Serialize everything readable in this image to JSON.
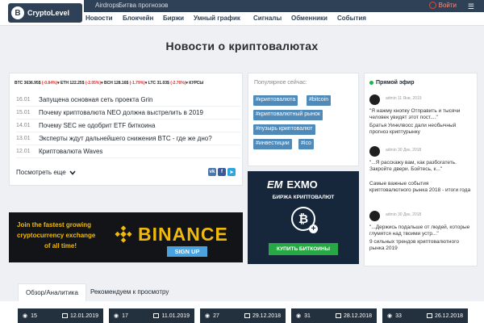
{
  "header": {
    "logo_text": "CryptoLevel",
    "logo_mark": "B",
    "subnav": [
      "Airdrops",
      "Битва прогнозов"
    ],
    "login_label": "Войти",
    "login_icon": "power-icon",
    "menu_icon": "hamburger-icon",
    "mainnav": [
      "Новости",
      "Блокчейн",
      "Биржи",
      "Умный график",
      "Сигналы",
      "Обменники",
      "События"
    ]
  },
  "page": {
    "title": "Новости о криптовалютах"
  },
  "ticker": [
    {
      "symbol": "BTC",
      "price": "3636.95$",
      "change": "(-0.84%)"
    },
    {
      "symbol": "ETH",
      "price": "122.25$",
      "change": "(-2.05%)"
    },
    {
      "symbol": "BCH",
      "price": "128.16$",
      "change": "(-1.79%)"
    },
    {
      "symbol": "LTC",
      "price": "31.03$",
      "change": "(-2.76%)"
    },
    {
      "label": "КУРСЫ"
    }
  ],
  "news": {
    "items": [
      {
        "date": "16.01",
        "title": "Запущена основная сеть проекта Grin"
      },
      {
        "date": "15.01",
        "title": "Почему криптовалюта NEO должна выстрелить в 2019"
      },
      {
        "date": "14.01",
        "title": "Почему SEC не одобрит ETF биткоина"
      },
      {
        "date": "13.01",
        "title": "Эксперты ждут дальнейшего снижения BTC - где же дно?"
      },
      {
        "date": "12.01",
        "title": "Криптовалюта Waves"
      }
    ],
    "more_label": "Посмотреть еще",
    "more_icon": "chevron-down-icon",
    "share": [
      {
        "icon": "vk-icon",
        "glyph": "vk",
        "color": "#4a76a8"
      },
      {
        "icon": "facebook-icon",
        "glyph": "f",
        "color": "#3b5998"
      },
      {
        "icon": "telegram-icon",
        "glyph": "➤",
        "color": "#2ca5e0"
      }
    ]
  },
  "tags": {
    "title": "Популярное сейчас:",
    "items": [
      "#криптовалюта",
      "#bitcoin",
      "#криптовалютный рынок",
      "#пузырь криптовалют",
      "#инвестиции",
      "#ico"
    ],
    "color": "#4f8ab8"
  },
  "live": {
    "title": "Прямой эфир",
    "items": [
      {
        "meta": "admin 11 Янв, 2019",
        "quote": "\"Я нажму кнопку Отправить и тысячи человек увидят этот пост....\"",
        "post": "Братья Уинклвосс дали необычный прогноз криптурынку"
      },
      {
        "meta": "admin 30 Дек, 2018",
        "quote": "\"...Я расскажу вам, как разбогатеть. Закройте двери. Бойтесь, к...\"",
        "post": "Самые важные события криптовалютного рынка 2018 - итоги года"
      },
      {
        "meta": "admin 30 Дек, 2018",
        "quote": "\"...Держись подальше от людей, которые глумятся над твоими устр...\"",
        "post": "9 сильных трендов криптовалютного рынка 2019"
      }
    ]
  },
  "banners": {
    "binance": {
      "lines": [
        "Join the fastest growing",
        "cryptocurrency exchange",
        "of all time!"
      ],
      "name": "BINANCE",
      "cta": "SIGN UP"
    },
    "exmo": {
      "logo_mark": "EM",
      "name": "EXMO",
      "subtitle": "БИРЖА КРИПТОВАЛЮТ",
      "coin_glyph": "₿",
      "plus": "+",
      "cta": "КУПИТЬ БИТКОИНЫ"
    }
  },
  "tabs": [
    "Обзор/Аналитика",
    "Рекомендуем к просмотру"
  ],
  "cards": [
    {
      "views": "15",
      "date": "12.01.2019"
    },
    {
      "views": "17",
      "date": "11.01.2019"
    },
    {
      "views": "27",
      "date": "29.12.2018"
    },
    {
      "views": "31",
      "date": "28.12.2018"
    },
    {
      "views": "33",
      "date": "26.12.2018"
    }
  ]
}
